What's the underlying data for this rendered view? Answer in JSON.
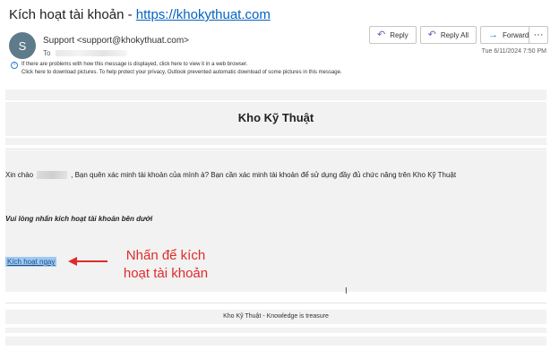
{
  "message": {
    "subject_prefix": "Kích hoạt tài khoản - ",
    "subject_link": "https://khokythuat.com",
    "avatar_letter": "S",
    "sender": "Support <support@khokythuat.com>",
    "to_label": "To",
    "timestamp": "Tue 6/11/2024 7:50 PM",
    "info_line1": "If there are problems with how this message is displayed, click here to view it in a web browser.",
    "info_line2": "Click here to download pictures. To help protect your privacy, Outlook prevented automatic download of some pictures in this message."
  },
  "actions": {
    "reply": "Reply",
    "reply_all": "Reply All",
    "forward": "Forward",
    "more": "···"
  },
  "email_body": {
    "heading": "Kho Kỹ Thuật",
    "greeting_prefix": "Xin chào",
    "greeting_suffix": ", Bạn quên xác minh tài khoản của mình à? Bạn cần xác minh tài khoản để sử dụng đầy đủ chức năng trên Kho Kỹ Thuật",
    "instruction": "Vui lòng nhấn kích hoạt tài khoản bên dưới",
    "activate_link": "Kích hoạt ngay",
    "annotation_line1": "Nhấn để kích",
    "annotation_line2": "hoạt tài khoản",
    "footer": "Kho Kỹ Thuật - Knowledge is treasure"
  },
  "colors": {
    "link": "#0563c1",
    "annotation": "#e02b2b",
    "highlight": "#9ec9f2"
  }
}
